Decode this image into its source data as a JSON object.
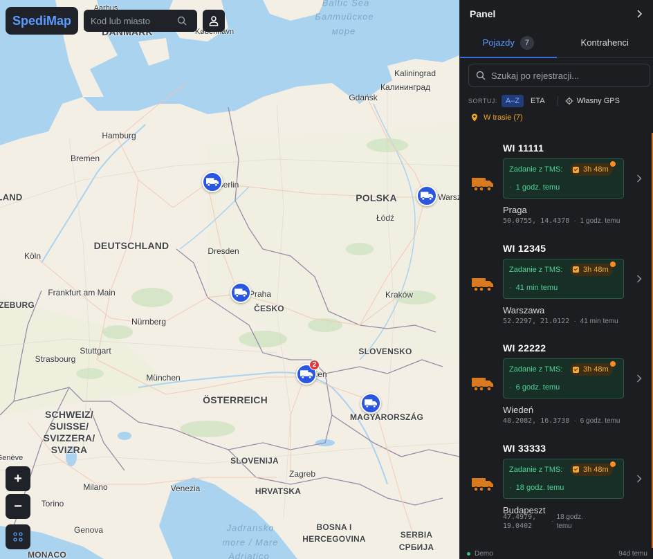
{
  "map": {
    "brand": "SpediMap",
    "search_placeholder": "Kod lub miasto",
    "zoom_in": "+",
    "zoom_out": "−",
    "labels": {
      "baltic_sea": "Baltic Sea",
      "baltic_ru": "Балтийское",
      "baltic_ru2": "море",
      "denmark": "DANMARK",
      "kobenhavn": "København",
      "aarhus": "Aarhus",
      "kaliningrad": "Kaliningrad",
      "kaliningrad_ru": "Калининград",
      "gdansk": "Gdańsk",
      "hamburg": "Hamburg",
      "bremen": "Bremen",
      "berlin": "Berlin",
      "polska": "POLSKA",
      "warszawa": "Warsz",
      "lodz": "Łódź",
      "land": "LAND",
      "deutschland": "DEUTSCHLAND",
      "koln": "Köln",
      "dresden": "Dresden",
      "frankfurt": "Frankfurt am Main",
      "praha": "Praha",
      "cesko": "ČESKO",
      "krakow": "Kraków",
      "zeburg": "ZEBURG",
      "nurnberg": "Nürnberg",
      "stuttgart": "Stuttgart",
      "strasbourg": "Strasbourg",
      "slovensko": "SLOVENSKO",
      "munchen": "München",
      "wien": "Wien",
      "osterreich": "ÖSTERREICH",
      "magyarorszag": "MAGYARORSZÁG",
      "schweiz1": "SCHWEIZ/",
      "schweiz2": "SUISSE/",
      "schweiz3": "SVIZZERA/",
      "schweiz4": "SVIZRA",
      "geneve": "Genève",
      "slovenija": "SLOVENIJA",
      "zagreb": "Zagreb",
      "milano": "Milano",
      "venezia": "Venezia",
      "hrvatska": "HRVATSKA",
      "torino": "Torino",
      "genova": "Genova",
      "jadransko1": "Jadransko",
      "jadransko2": "more / Mare",
      "adriatico": "Adriatico",
      "bosna1": "BOSNA I",
      "bosna2": "HERCEGOVINA",
      "srbija1": "SERBIA",
      "srbija2": "СРБИЈА",
      "monaco": "MONACO"
    },
    "cluster_count": "2"
  },
  "panel": {
    "title": "Panel",
    "tabs": [
      {
        "label": "Pojazdy",
        "count": "7"
      },
      {
        "label": "Kontrahenci"
      }
    ],
    "search_placeholder": "Szukaj po rejestracji...",
    "sort_label": "SORTUJ:",
    "sort_az": "A–Z",
    "sort_eta": "ETA",
    "gps_label": "Własny GPS",
    "group_label": "W trasie (7)",
    "vehicles": [
      {
        "plate": "WI 11111",
        "tms": "Zadanie z TMS:",
        "eta": "3h 48m",
        "ago": "1 godz. temu",
        "city": "Praga",
        "coords": "50.0755, 14.4378",
        "updated": "1 godz. temu"
      },
      {
        "plate": "WI 12345",
        "tms": "Zadanie z TMS:",
        "eta": "3h 48m",
        "ago": "41 min temu",
        "city": "Warszawa",
        "coords": "52.2297, 21.0122",
        "updated": "41 min temu"
      },
      {
        "plate": "WI 22222",
        "tms": "Zadanie z TMS:",
        "eta": "3h 48m",
        "ago": "6 godz. temu",
        "city": "Wiedeń",
        "coords": "48.2082, 16.3738",
        "updated": "6 godz. temu"
      },
      {
        "plate": "WI 33333",
        "tms": "Zadanie z TMS:",
        "eta": "3h 48m",
        "ago": "18 godz. temu",
        "city": "Budapeszt",
        "coords_1": "47.4979,",
        "coords_2": "19.0402",
        "updated_1": "18 godz.",
        "updated_2": "temu"
      }
    ],
    "footer_status": "Demo",
    "footer_time": "94d temu",
    "colors": {
      "accent": "#3b6fe0",
      "tms_green": "#4fd494",
      "eta_orange": "#f2a93b",
      "truck_orange": "#d97a1e"
    }
  }
}
